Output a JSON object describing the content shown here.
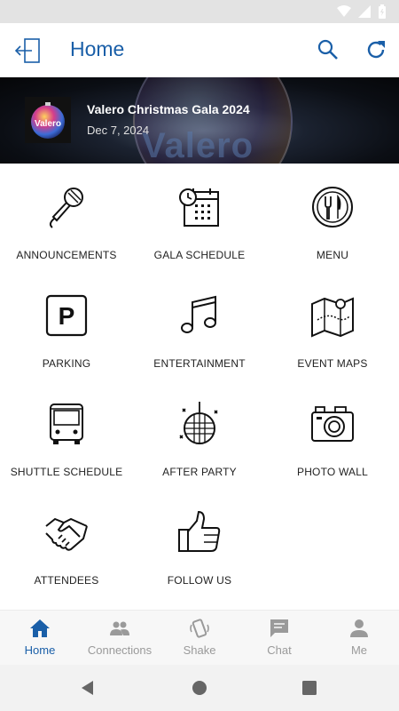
{
  "app_bar": {
    "title": "Home"
  },
  "banner": {
    "event_title": "Valero Christmas Gala 2024",
    "event_date": "Dec 7, 2024",
    "logo_text": "Valero"
  },
  "tiles": [
    {
      "label": "ANNOUNCEMENTS",
      "icon": "microphone-icon"
    },
    {
      "label": "GALA SCHEDULE",
      "icon": "calendar-clock-icon"
    },
    {
      "label": "MENU",
      "icon": "plate-fork-knife-icon"
    },
    {
      "label": "PARKING",
      "icon": "parking-icon"
    },
    {
      "label": "ENTERTAINMENT",
      "icon": "music-note-icon"
    },
    {
      "label": "EVENT MAPS",
      "icon": "map-icon"
    },
    {
      "label": "SHUTTLE SCHEDULE",
      "icon": "bus-icon"
    },
    {
      "label": "AFTER PARTY",
      "icon": "disco-ball-icon"
    },
    {
      "label": "PHOTO WALL",
      "icon": "camera-icon"
    },
    {
      "label": "ATTENDEES",
      "icon": "handshake-icon"
    },
    {
      "label": "FOLLOW US",
      "icon": "thumbs-up-icon"
    }
  ],
  "bottom_nav": [
    {
      "label": "Home",
      "icon": "home-icon",
      "active": true
    },
    {
      "label": "Connections",
      "icon": "people-icon",
      "active": false
    },
    {
      "label": "Shake",
      "icon": "shake-phone-icon",
      "active": false
    },
    {
      "label": "Chat",
      "icon": "chat-bubble-icon",
      "active": false
    },
    {
      "label": "Me",
      "icon": "person-icon",
      "active": false
    }
  ],
  "colors": {
    "accent": "#1a5fa8",
    "inactive": "#9a9a9a",
    "status_bar": "#e3e3e3"
  }
}
